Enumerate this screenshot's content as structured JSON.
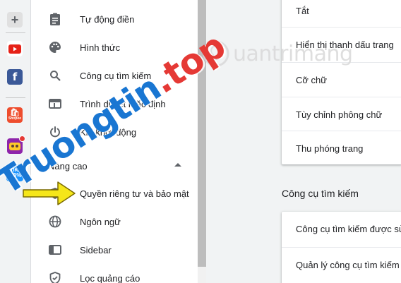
{
  "sidebar_strip": {
    "items": [
      {
        "name": "add-panel-icon",
        "glyph": "+",
        "color": "#5f6368"
      },
      {
        "name": "youtube-icon",
        "glyph": "▶",
        "color": "#e62117"
      },
      {
        "name": "facebook-icon",
        "glyph": "f",
        "color": "#3b5998"
      },
      {
        "name": "shopee-icon",
        "glyph": "S",
        "color": "#ee4d2d"
      },
      {
        "name": "game-icon",
        "glyph": "✦",
        "color": "#6a1b9a"
      },
      {
        "name": "tiki-icon",
        "glyph": "TIKI -50%",
        "color": "#1a94ff"
      }
    ],
    "tiki_label": "TIKI",
    "tiki_discount": "-50%",
    "shopee_label": "Shopee"
  },
  "menu": {
    "items": [
      {
        "label": "Tự động điền",
        "icon": "clipboard-icon"
      },
      {
        "label": "Hình thức",
        "icon": "palette-icon"
      },
      {
        "label": "Công cụ tìm kiếm",
        "icon": "search-icon"
      },
      {
        "label": "Trình duyệt mặc định",
        "icon": "browser-window-icon"
      },
      {
        "label": "Khi khởi động",
        "icon": "power-icon"
      }
    ],
    "advanced_section": "Nâng cao",
    "advanced_items": [
      {
        "label": "Quyền riêng tư và bảo mật",
        "icon": "shield-icon"
      },
      {
        "label": "Ngôn ngữ",
        "icon": "globe-icon"
      },
      {
        "label": "Sidebar",
        "icon": "sidebar-icon"
      },
      {
        "label": "Lọc quảng cáo",
        "icon": "shield-check-icon"
      }
    ]
  },
  "main": {
    "appearance_card": {
      "rows": [
        {
          "label": "Tắt"
        },
        {
          "label": "Hiển thị thanh dấu trang"
        },
        {
          "label": "Cỡ chữ"
        },
        {
          "label": "Tùy chỉnh phông chữ"
        },
        {
          "label": "Thu phóng trang"
        }
      ]
    },
    "search_engine_heading": "Công cụ tìm kiếm",
    "search_card": {
      "rows": [
        {
          "label": "Công cụ tìm kiếm được sử"
        },
        {
          "label": "Quản lý công cụ tìm kiếm"
        }
      ]
    }
  },
  "watermarks": {
    "logo_text": "uantrimang",
    "logo_q": "Q",
    "diagonal_blue": "Truongtin",
    "diagonal_red": ".top"
  },
  "colors": {
    "arrow_fill": "#f5e61a",
    "arrow_stroke": "#7a6a00",
    "accent_blue": "#1976d2",
    "accent_red": "#e53935"
  }
}
